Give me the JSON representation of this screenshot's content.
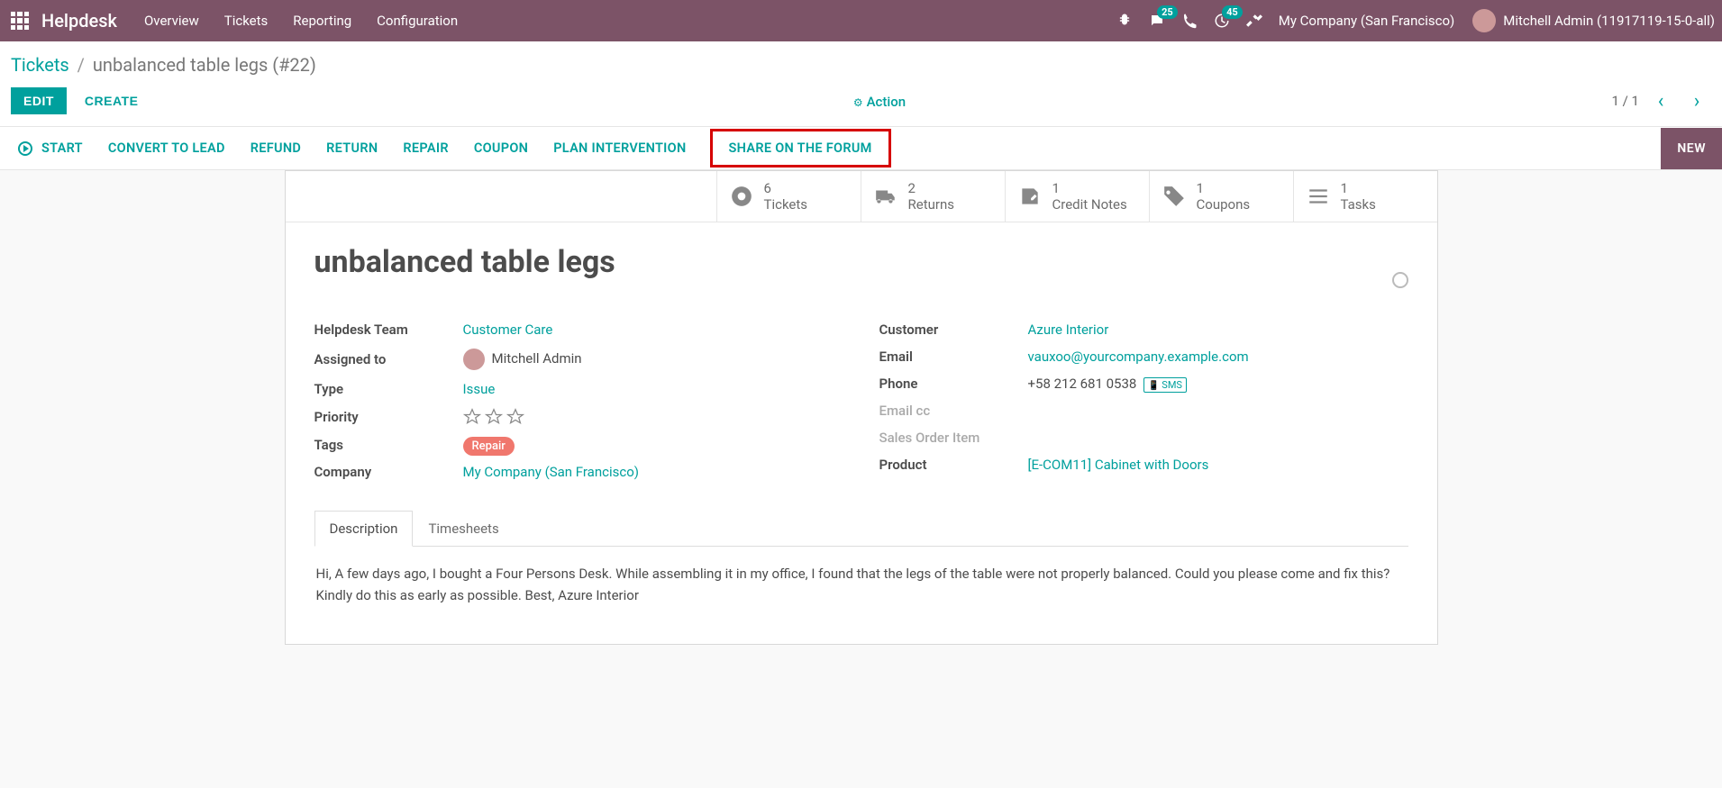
{
  "topnav": {
    "brand": "Helpdesk",
    "menu": [
      "Overview",
      "Tickets",
      "Reporting",
      "Configuration"
    ],
    "messages_badge": "25",
    "activities_badge": "45",
    "company": "My Company (San Francisco)",
    "user": "Mitchell Admin (11917119-15-0-all)"
  },
  "breadcrumb": {
    "root": "Tickets",
    "current": "unbalanced table legs (#22)"
  },
  "controlbar": {
    "edit": "EDIT",
    "create": "CREATE",
    "action": "Action",
    "pager": "1 / 1"
  },
  "statusbar": {
    "actions": [
      "START",
      "CONVERT TO LEAD",
      "REFUND",
      "RETURN",
      "REPAIR",
      "COUPON",
      "PLAN INTERVENTION",
      "SHARE ON THE FORUM"
    ],
    "stage": "NEW"
  },
  "stats": [
    {
      "count": "6",
      "label": "Tickets"
    },
    {
      "count": "2",
      "label": "Returns"
    },
    {
      "count": "1",
      "label": "Credit Notes"
    },
    {
      "count": "1",
      "label": "Coupons"
    },
    {
      "count": "1",
      "label": "Tasks"
    }
  ],
  "record": {
    "title": "unbalanced table legs",
    "left": {
      "team_label": "Helpdesk Team",
      "team": "Customer Care",
      "assigned_label": "Assigned to",
      "assigned": "Mitchell Admin",
      "type_label": "Type",
      "type": "Issue",
      "priority_label": "Priority",
      "tags_label": "Tags",
      "tag": "Repair",
      "company_label": "Company",
      "company": "My Company (San Francisco)"
    },
    "right": {
      "customer_label": "Customer",
      "customer": "Azure Interior",
      "email_label": "Email",
      "email": "vauxoo@yourcompany.example.com",
      "phone_label": "Phone",
      "phone": "+58 212 681 0538",
      "sms": "SMS",
      "emailcc_label": "Email cc",
      "sales_order_label": "Sales Order Item",
      "product_label": "Product",
      "product": "[E-COM11] Cabinet with Doors"
    }
  },
  "tabs": {
    "description": "Description",
    "timesheets": "Timesheets"
  },
  "description_body": "Hi, A few days ago, I bought a Four Persons Desk. While assembling it in my office, I found that the legs of the table were not properly balanced. Could you please come and fix this? Kindly do this as early as possible. Best, Azure Interior"
}
